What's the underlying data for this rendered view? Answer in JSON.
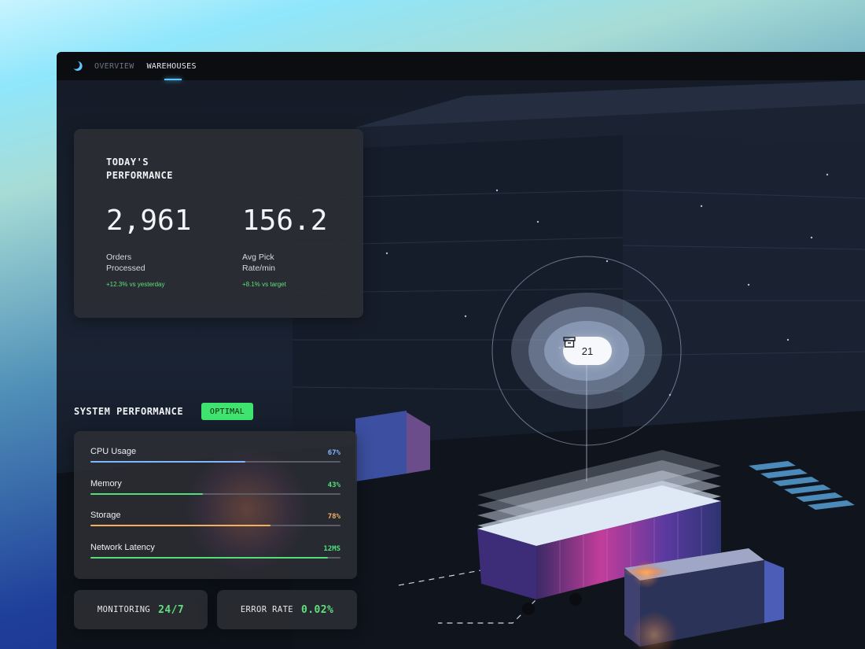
{
  "nav": {
    "tabs": [
      {
        "label": "OVERVIEW",
        "active": false
      },
      {
        "label": "WAREHOUSES",
        "active": true
      }
    ]
  },
  "performance": {
    "title": "TODAY'S PERFORMANCE",
    "metrics": [
      {
        "value": "2,961",
        "label": "Orders Processed",
        "delta": "+12.3% vs yesterday"
      },
      {
        "value": "156.2",
        "label": "Avg Pick Rate/min",
        "delta": "+8.1% vs target"
      }
    ]
  },
  "system": {
    "title": "SYSTEM PERFORMANCE",
    "badge": "OPTIMAL",
    "rows": [
      {
        "name": "CPU Usage",
        "value": "67%",
        "fraction": 0.62,
        "color": "#7fb6ff"
      },
      {
        "name": "Memory",
        "value": "43%",
        "fraction": 0.45,
        "color": "#4fe07a"
      },
      {
        "name": "Storage",
        "value": "78%",
        "fraction": 0.72,
        "color": "#f0b060"
      },
      {
        "name": "Network Latency",
        "value": "12MS",
        "fraction": 0.95,
        "color": "#4fe07a"
      }
    ]
  },
  "footer": {
    "monitoring_label": "MONITORING",
    "monitoring_value": "24/7",
    "error_label": "ERROR RATE",
    "error_value": "0.02%"
  },
  "marker": {
    "count": "21",
    "icon": "archive-box-icon"
  },
  "colors": {
    "accent": "#57c6ff",
    "success": "#3ee46d",
    "delta": "#5fe07c",
    "warning": "#f0b060"
  }
}
